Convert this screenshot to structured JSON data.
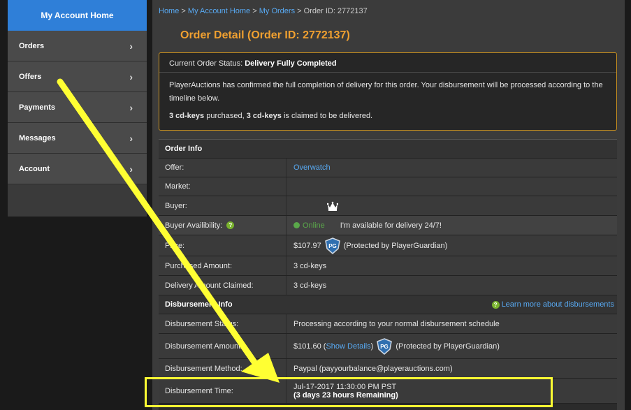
{
  "sidebar": {
    "header": "My Account Home",
    "items": [
      {
        "label": "Orders"
      },
      {
        "label": "Offers"
      },
      {
        "label": "Payments"
      },
      {
        "label": "Messages"
      },
      {
        "label": "Account"
      }
    ],
    "chevron": "›"
  },
  "breadcrumb": {
    "home": "Home",
    "account": "My Account Home",
    "orders": "My Orders",
    "current": "Order ID: 2772137",
    "sep": ">"
  },
  "page_title": "Order Detail (Order ID: 2772137)",
  "status": {
    "label": "Current Order Status:",
    "value": "Delivery Fully Completed",
    "message": "PlayerAuctions has confirmed the full completion of delivery for this order. Your disbursement will be processed according to the timeline below.",
    "purchased_count": "3 cd-keys",
    "purchased_text": "purchased,",
    "claimed_count": "3 cd-keys",
    "claimed_text": "is claimed to be delivered."
  },
  "order_info": {
    "title": "Order Info",
    "offer_label": "Offer:",
    "offer_value": "Overwatch",
    "market_label": "Market:",
    "buyer_label": "Buyer:",
    "buyer_icon": "crown-icon",
    "availability_label": "Buyer Availibility:",
    "online_status": "Online",
    "availability_text": "I'm available for delivery 24/7!",
    "price_label": "Price:",
    "price_value": "$107.97",
    "protected_text": "(Protected by PlayerGuardian)",
    "purchased_amount_label": "Purchased Amount:",
    "purchased_amount_value": "3 cd-keys",
    "delivery_claimed_label": "Delivery Amount Claimed:",
    "delivery_claimed_value": "3 cd-keys"
  },
  "disbursement": {
    "title": "Disbursement Info",
    "learn_more": "Learn more about disbursements",
    "status_label": "Disbursement Status:",
    "status_value": "Processing according to your normal disbursement schedule",
    "amount_label": "Disbursement Amount:",
    "amount_value": "$101.60",
    "show_details": "Show Details",
    "protected_text": "(Protected by PlayerGuardian)",
    "method_label": "Disbursement Method:",
    "method_value": "Paypal (payyourbalance@playerauctions.com)",
    "time_label": "Disbursement Time:",
    "time_value": "Jul-17-2017 11:30:00 PM PST",
    "time_remaining": "(3 days 23 hours Remaining)"
  },
  "colors": {
    "accent_blue": "#2f7fd8",
    "link_blue": "#58a9f2",
    "title_orange": "#f0a030",
    "annotation_yellow": "#ffff33",
    "online_green": "#5aa84a"
  }
}
